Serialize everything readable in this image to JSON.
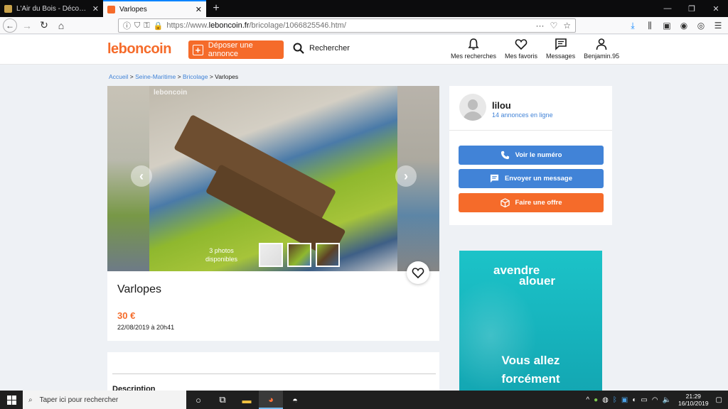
{
  "browser": {
    "tabs": [
      {
        "title": "L'Air du Bois - Découvrez, fabr",
        "active": false
      },
      {
        "title": "Varlopes",
        "active": true
      }
    ],
    "url_prefix": "https://www.",
    "url_domain": "leboncoin.fr",
    "url_path": "/bricolage/1066825546.htm/"
  },
  "site": {
    "logo": "leboncoin",
    "post_ad_label": "Déposer une annonce",
    "search_label": "Rechercher",
    "nav": {
      "searches": "Mes recherches",
      "favorites": "Mes favoris",
      "messages": "Messages",
      "account": "Benjamin.95"
    }
  },
  "breadcrumb": {
    "home": "Accueil",
    "region": "Seine-Maritime",
    "category": "Bricolage",
    "current": "Varlopes",
    "separator": ">"
  },
  "gallery": {
    "watermark": "leboncoin",
    "photo_count_line1": "3 photos",
    "photo_count_line2": "disponibles"
  },
  "ad": {
    "title": "Varlopes",
    "price": "30 €",
    "date": "22/08/2019 à 20h41",
    "description_heading": "Description"
  },
  "seller": {
    "name": "lilou",
    "ads_online": "14 annonces en ligne",
    "call_label": "Voir le numéro",
    "message_label": "Envoyer un message",
    "offer_label": "Faire une offre"
  },
  "banner": {
    "logo_line1": "avendre",
    "logo_line2": "alouer",
    "text_line1": "Vous allez",
    "text_line2": "forcément"
  },
  "taskbar": {
    "search_placeholder": "Taper ici pour rechercher",
    "time": "21:29",
    "date": "16/10/2019"
  },
  "colors": {
    "brand_orange": "#f56b2a",
    "brand_blue": "#4183d7",
    "banner_teal": "#17b5be"
  }
}
